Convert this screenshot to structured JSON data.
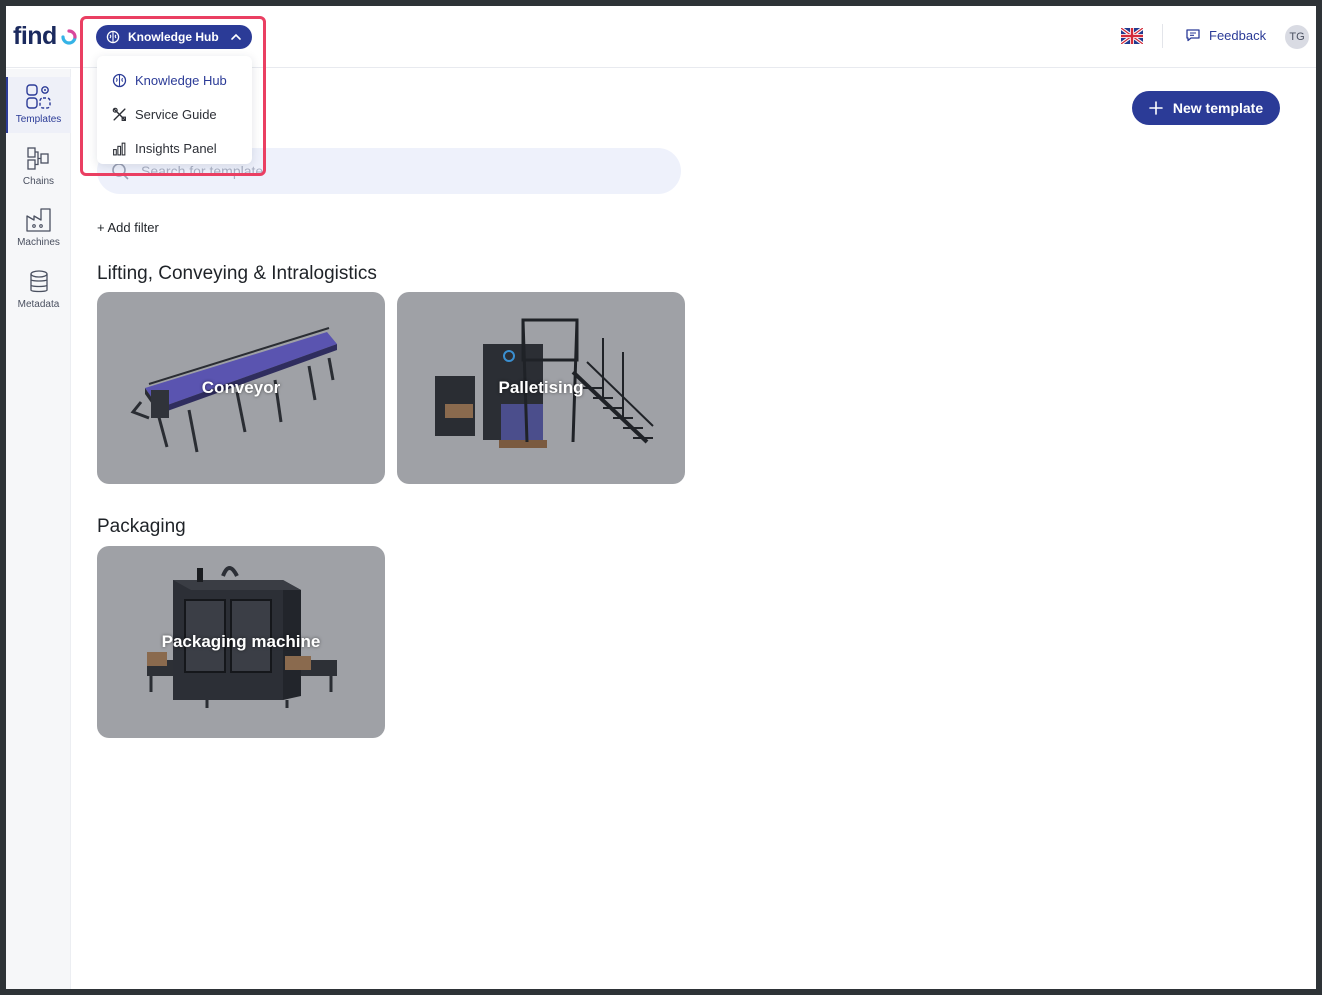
{
  "header": {
    "logo_text": "find",
    "hub_switcher_label": "Knowledge Hub",
    "feedback_label": "Feedback",
    "avatar_initials": "TG",
    "language_flag": "uk-flag-icon"
  },
  "hub_menu": {
    "items": [
      {
        "label": "Knowledge Hub",
        "icon": "brain-icon",
        "active": true
      },
      {
        "label": "Service Guide",
        "icon": "tools-icon",
        "active": false
      },
      {
        "label": "Insights Panel",
        "icon": "bar-chart-icon",
        "active": false
      }
    ]
  },
  "sidebar": {
    "items": [
      {
        "label": "Templates",
        "icon": "templates-icon",
        "active": true
      },
      {
        "label": "Chains",
        "icon": "chains-icon",
        "active": false
      },
      {
        "label": "Machines",
        "icon": "factory-icon",
        "active": false
      },
      {
        "label": "Metadata",
        "icon": "database-icon",
        "active": false
      }
    ]
  },
  "main": {
    "new_template_label": "New template",
    "search_placeholder": "Search for template",
    "add_filter_label": "+ Add filter",
    "sections": [
      {
        "title": "Lifting, Conveying & Intralogistics",
        "cards": [
          "Conveyor",
          "Palletising"
        ]
      },
      {
        "title": "Packaging",
        "cards": [
          "Packaging machine"
        ]
      }
    ]
  },
  "colors": {
    "primary": "#2b3b97",
    "highlight": "#ea3f62",
    "card_bg": "#9fa1a6",
    "search_bg": "#eef1fb"
  }
}
